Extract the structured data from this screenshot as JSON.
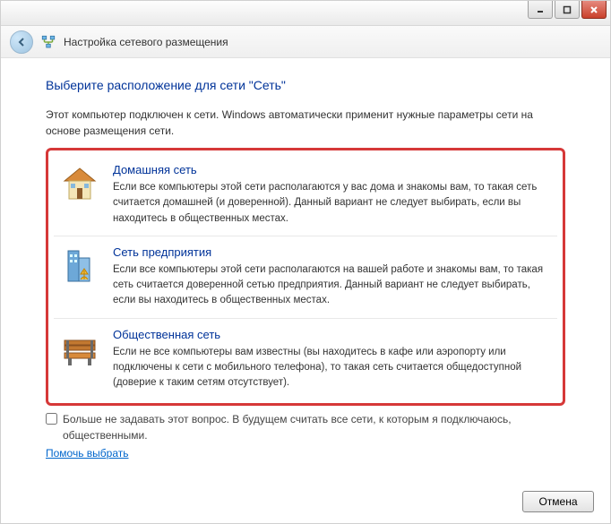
{
  "header": {
    "title": "Настройка сетевого размещения"
  },
  "page": {
    "title": "Выберите расположение для сети \"Сеть\"",
    "intro": "Этот компьютер подключен к сети. Windows автоматически применит нужные параметры сети на основе размещения сети."
  },
  "options": [
    {
      "title": "Домашняя сеть",
      "desc": "Если все компьютеры этой сети располагаются у вас дома и знакомы вам, то такая сеть считается домашней (и доверенной). Данный вариант не следует выбирать, если вы находитесь в общественных местах."
    },
    {
      "title": "Сеть предприятия",
      "desc": "Если все компьютеры этой сети располагаются на вашей работе и знакомы вам, то такая сеть считается доверенной сетью предприятия. Данный вариант не следует выбирать, если вы находитесь в общественных местах."
    },
    {
      "title": "Общественная сеть",
      "desc": "Если не все компьютеры вам известны (вы находитесь в кафе или аэропорту или подключены к сети с мобильного телефона), то такая сеть считается общедоступной (доверие к таким сетям отсутствует)."
    }
  ],
  "checkbox": {
    "label": "Больше не задавать этот вопрос. В будущем считать все сети, к которым я подключаюсь, общественными."
  },
  "help_link": "Помочь выбрать",
  "footer": {
    "cancel": "Отмена"
  }
}
